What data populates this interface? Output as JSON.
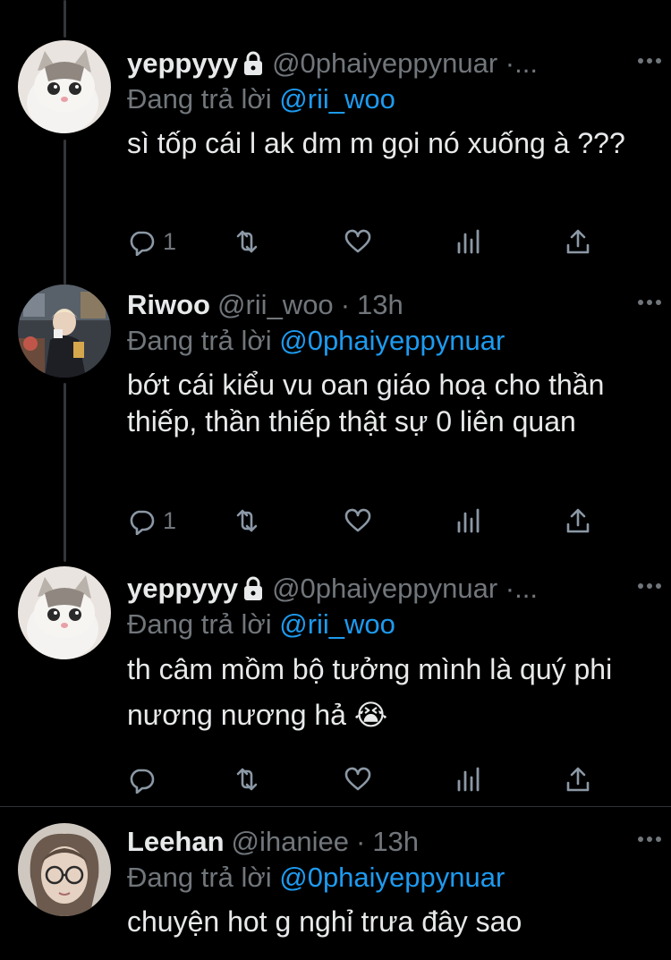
{
  "tweets": [
    {
      "name": "yeppyyy",
      "handle": "@0phaiyeppynuar ·...",
      "time": "",
      "protected": true,
      "reply_prefix": "Đang trả lời ",
      "reply_to": "@rii_woo",
      "text": "sì tốp cái l ak dm m gọi nó xuống à ???",
      "reply_count": "1",
      "avatar": "cat-avatar"
    },
    {
      "name": "Riwoo",
      "handle": "@rii_woo",
      "time": "13h",
      "protected": false,
      "reply_prefix": "Đang trả lời ",
      "reply_to": "@0phaiyeppynuar",
      "text": "bớt cái kiểu vu oan giáo hoạ cho thần thiếp, thần thiếp thật sự 0 liên quan",
      "reply_count": "1",
      "avatar": "photo-avatar"
    },
    {
      "name": "yeppyyy",
      "handle": "@0phaiyeppynuar ·...",
      "time": "",
      "protected": true,
      "reply_prefix": "Đang trả lời ",
      "reply_to": "@rii_woo",
      "text": "th câm mồm bộ tưởng mình là quý phi nương nương hả 😭",
      "reply_count": "",
      "avatar": "cat-avatar"
    },
    {
      "name": "Leehan",
      "handle": "@ihaniee",
      "time": "13h",
      "protected": false,
      "reply_prefix": "Đang trả lời ",
      "reply_to": "@0phaiyeppynuar",
      "text": "chuyện hot g nghỉ trưa đây sao",
      "reply_count": "",
      "avatar": "glasses-avatar"
    }
  ],
  "icons": [
    "reply-icon",
    "retweet-icon",
    "like-icon",
    "analytics-icon",
    "share-icon",
    "more-icon",
    "lock-icon"
  ],
  "colors": {
    "background": "#000000",
    "link": "#1d9bf0",
    "muted": "#71767b",
    "text": "#e7e9ea"
  }
}
